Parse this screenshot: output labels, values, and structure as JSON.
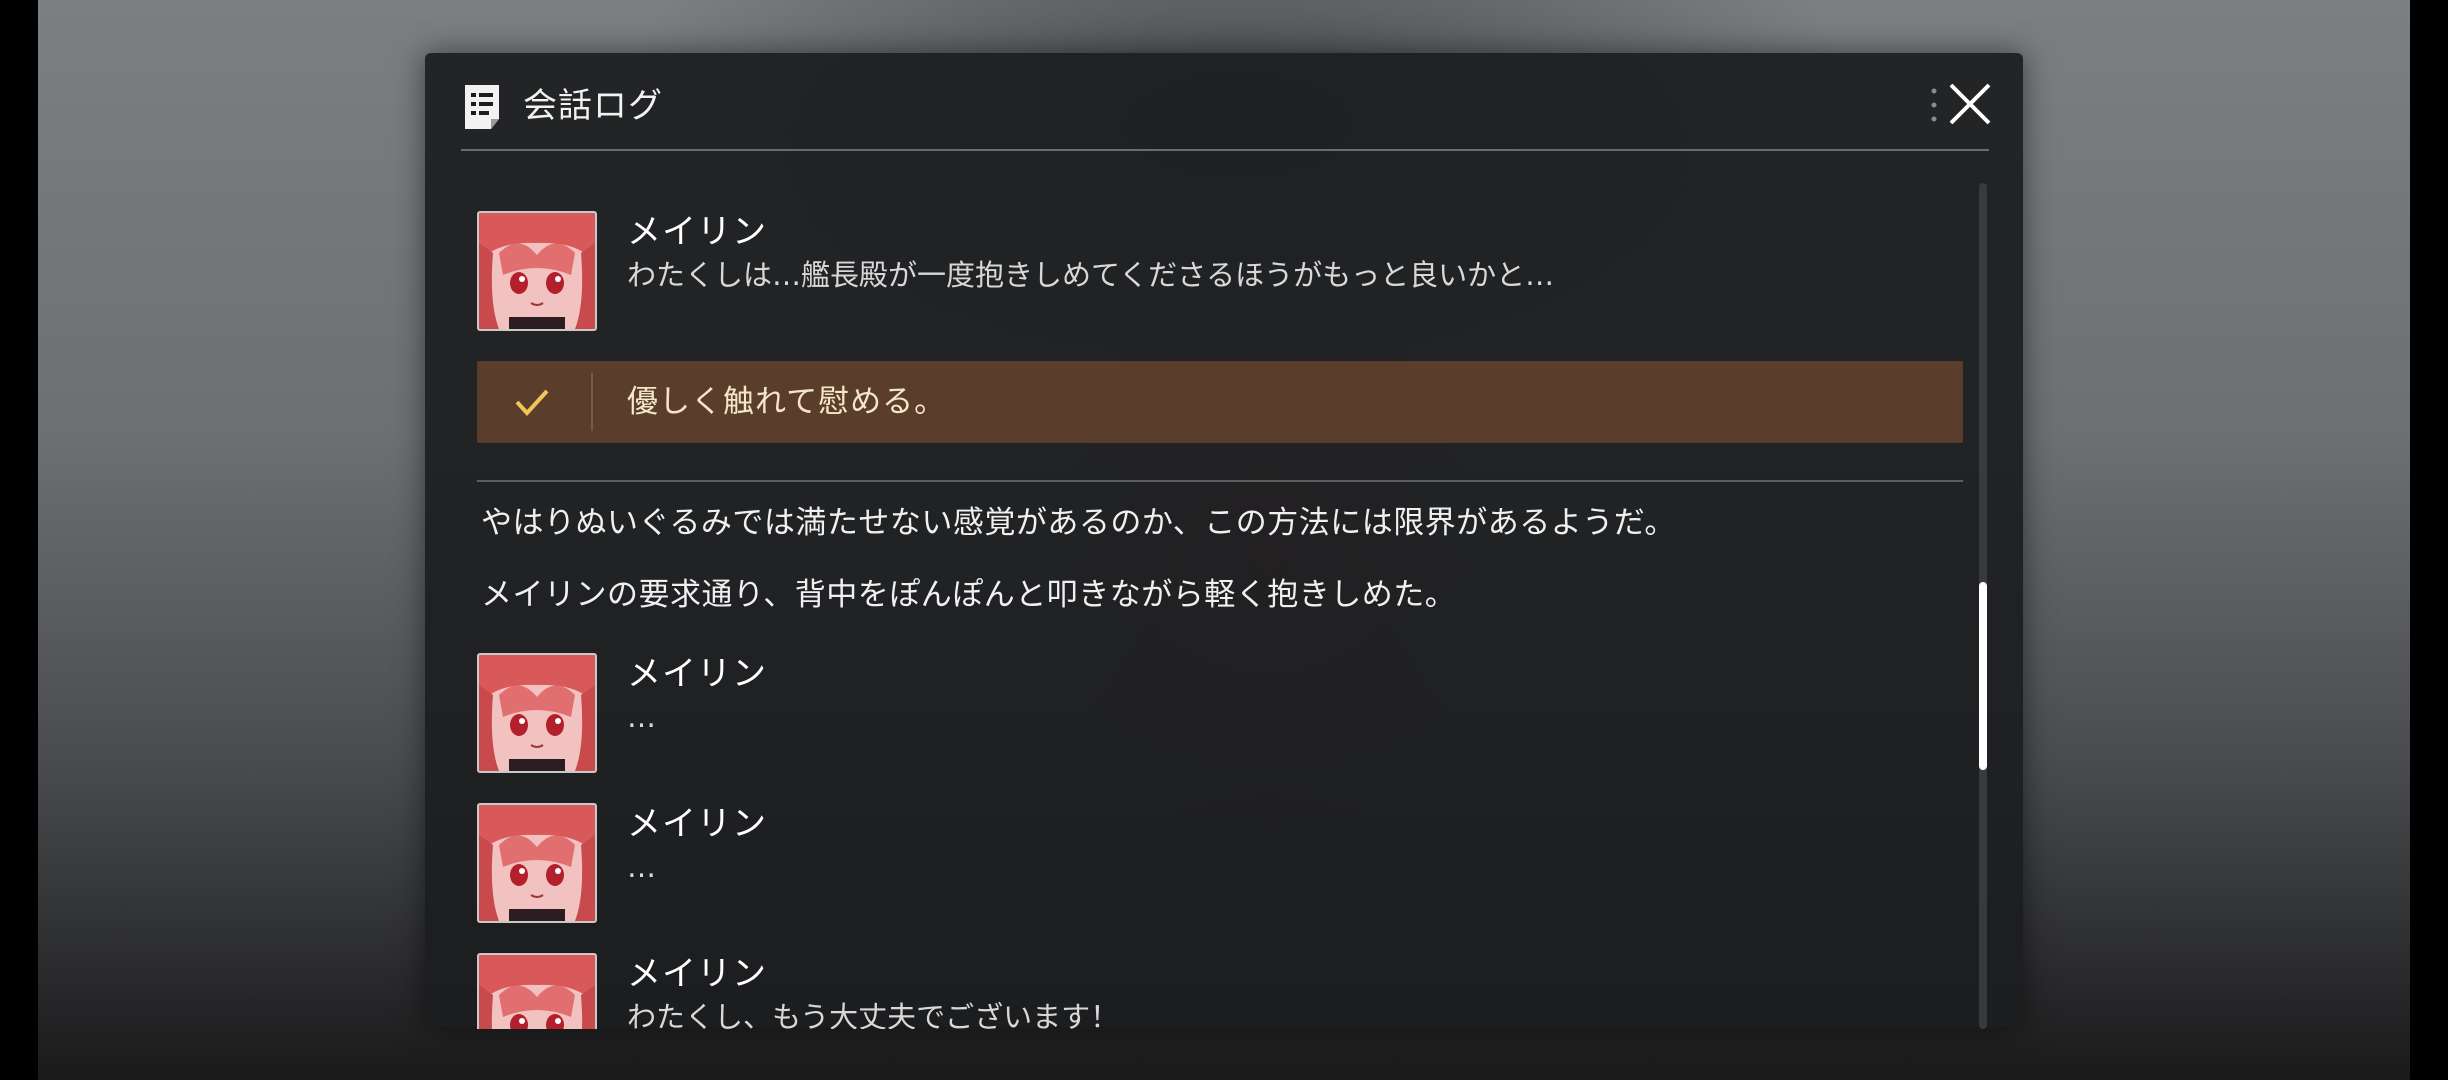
{
  "dialog": {
    "title": "会話ログ",
    "close_icon": "close-x-icon",
    "title_icon": "log-document-icon"
  },
  "log": {
    "entries": [
      {
        "speaker": "メイリン",
        "text": "わたくしは…艦長殿が一度抱きしめてくださるほうがもっと良いかと…"
      },
      {
        "speaker": "メイリン",
        "text": "…"
      },
      {
        "speaker": "メイリン",
        "text": "…"
      },
      {
        "speaker": "メイリン",
        "text": "わたくし、もう大丈夫でございます！"
      }
    ],
    "choice": {
      "text": "優しく触れて慰める。",
      "icon": "checkmark-icon"
    },
    "narration": [
      "やはりぬいぐるみでは満たせない感覚があるのか、この方法には限界があるようだ。",
      "メイリンの要求通り、背中をぽんぽんと叩きながら軽く抱きしめた。"
    ]
  },
  "colors": {
    "panel": "#1c1d1f",
    "choice_bg": "#5a3d2b",
    "choice_text": "#f4e6c8",
    "check": "#f2c45a"
  }
}
